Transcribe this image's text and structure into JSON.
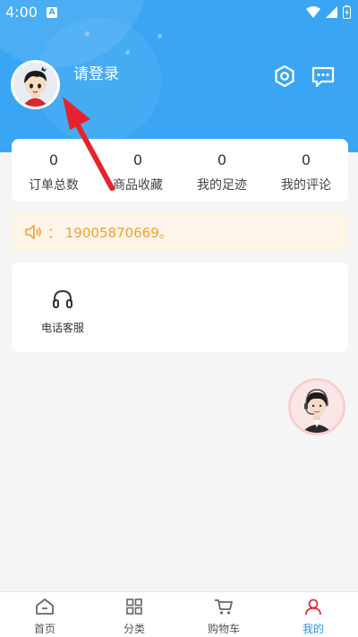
{
  "status_bar": {
    "time": "4:00",
    "notification_badge": "A"
  },
  "header": {
    "login_text": "请登录",
    "icons": {
      "settings": "settings-hexagon-icon",
      "messages": "message-dots-icon"
    }
  },
  "stats": [
    {
      "value": "0",
      "label": "订单总数"
    },
    {
      "value": "0",
      "label": "商品收藏"
    },
    {
      "value": "0",
      "label": "我的足迹"
    },
    {
      "value": "0",
      "label": "我的评论"
    }
  ],
  "notice": {
    "text": "： 19005870669。"
  },
  "services": [
    {
      "label": "电话客服",
      "icon": "headphones-icon"
    }
  ],
  "tabbar": [
    {
      "label": "首页",
      "icon": "home-icon"
    },
    {
      "label": "分类",
      "icon": "grid-icon"
    },
    {
      "label": "购物车",
      "icon": "cart-icon"
    },
    {
      "label": "我的",
      "icon": "user-icon",
      "active": true
    }
  ],
  "colors": {
    "header": "#3aa6f3",
    "accent": "#2e8fe8",
    "notice_text": "#f2a035",
    "notice_bg": "#fdf5e7",
    "arrow": "#e8222a"
  }
}
